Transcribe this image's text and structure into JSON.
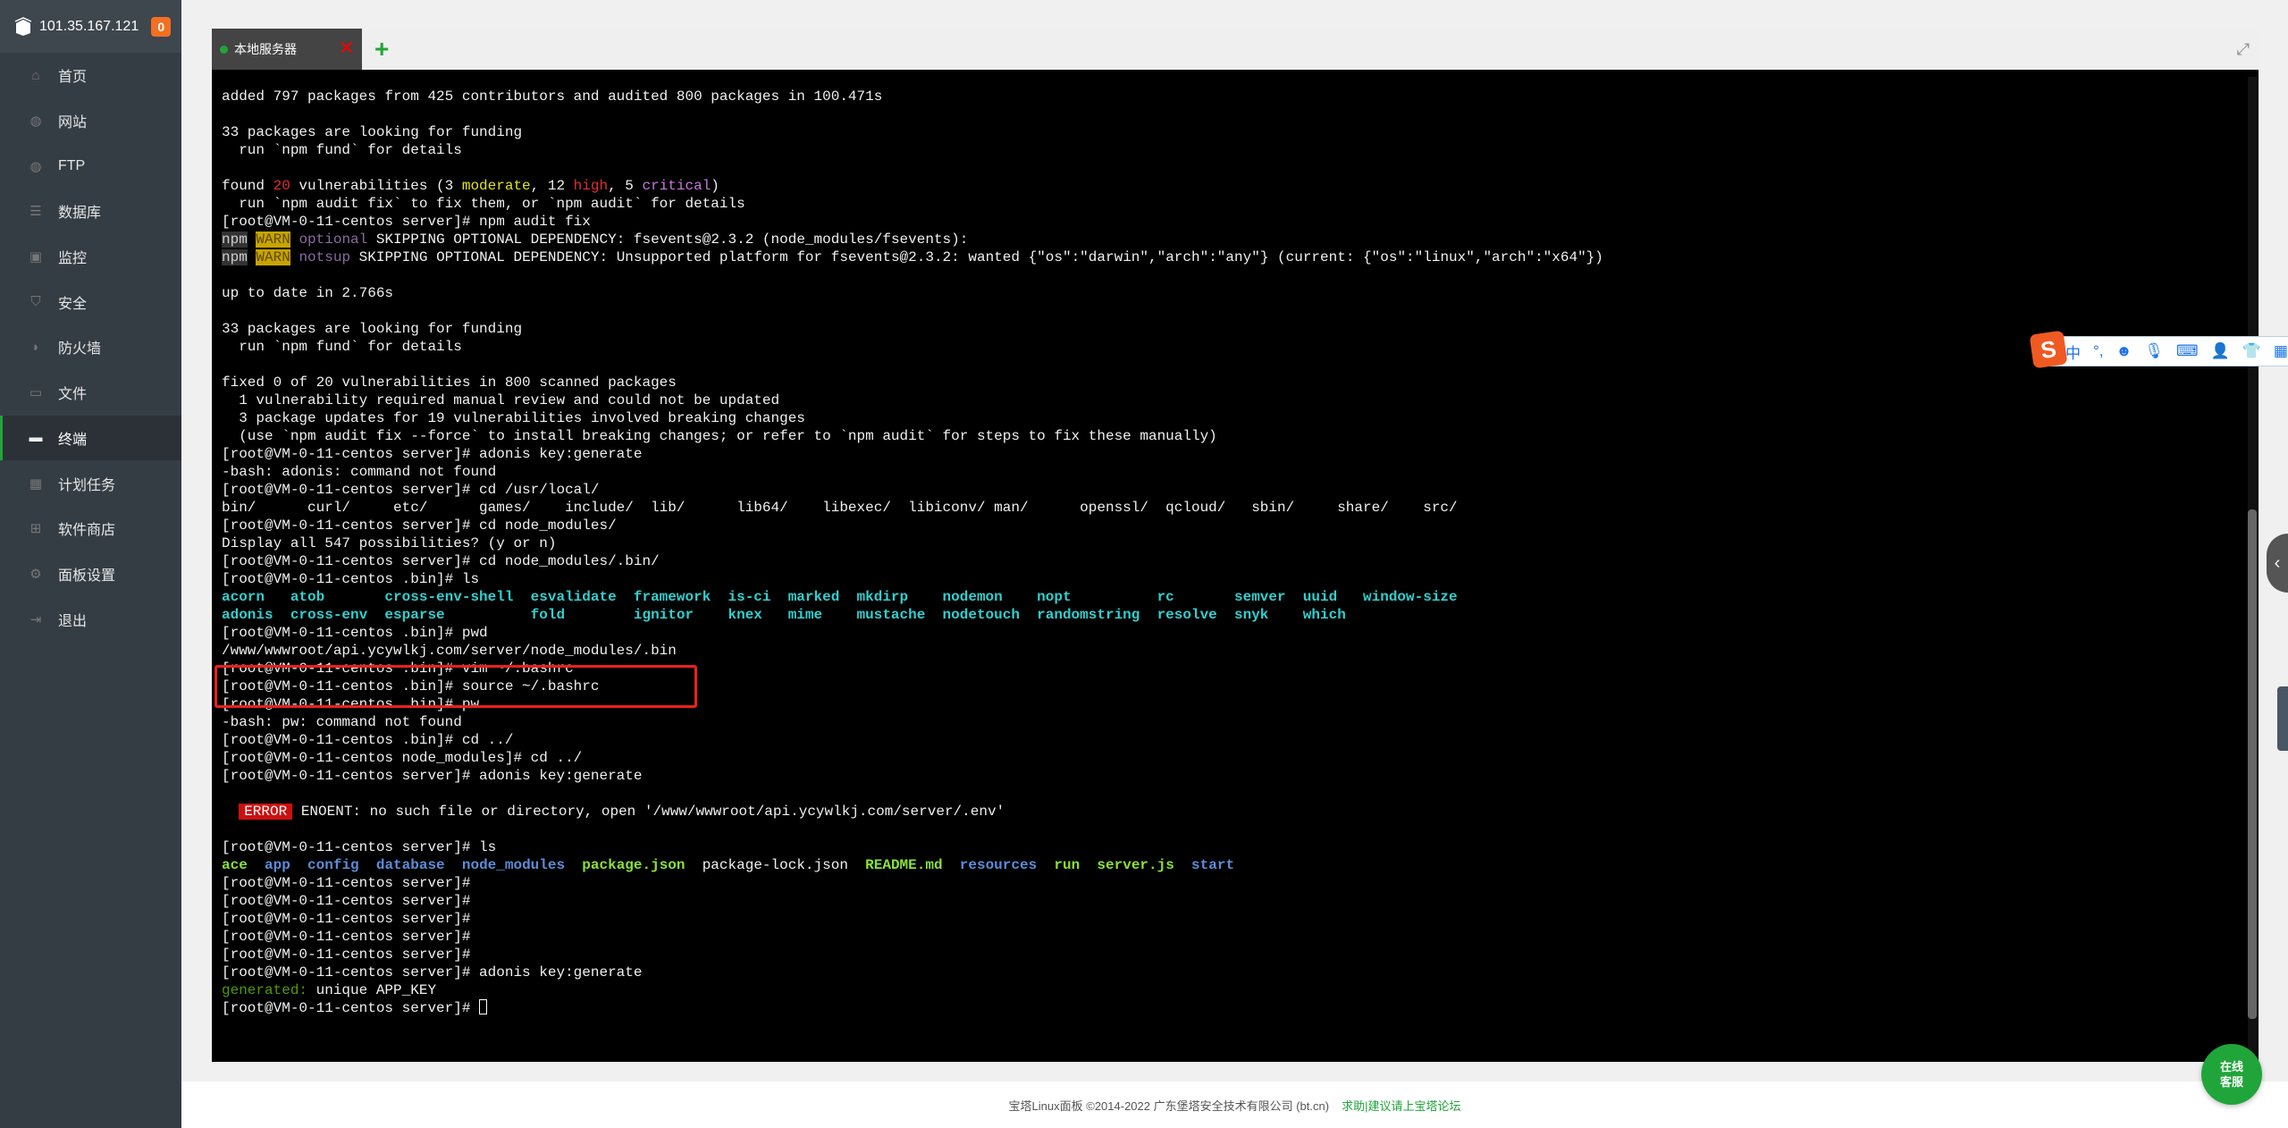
{
  "sidebar": {
    "server_ip": "101.35.167.121",
    "notification_count": "0",
    "items": [
      {
        "label": "首页",
        "icon": "home-icon"
      },
      {
        "label": "网站",
        "icon": "globe-icon"
      },
      {
        "label": "FTP",
        "icon": "ftp-icon"
      },
      {
        "label": "数据库",
        "icon": "database-icon"
      },
      {
        "label": "监控",
        "icon": "monitor-icon"
      },
      {
        "label": "安全",
        "icon": "shield-icon"
      },
      {
        "label": "防火墙",
        "icon": "firewall-icon"
      },
      {
        "label": "文件",
        "icon": "folder-icon"
      },
      {
        "label": "终端",
        "icon": "terminal-icon",
        "active": true
      },
      {
        "label": "计划任务",
        "icon": "calendar-icon"
      },
      {
        "label": "软件商店",
        "icon": "apps-icon"
      },
      {
        "label": "面板设置",
        "icon": "gear-icon"
      },
      {
        "label": "退出",
        "icon": "logout-icon"
      }
    ]
  },
  "tabs": {
    "active_tab": "本地服务器",
    "add_label": "+"
  },
  "terminal": {
    "prompt_server": "[root@VM-0-11-centos server]# ",
    "prompt_bin": "[root@VM-0-11-centos .bin]# ",
    "prompt_nm": "[root@VM-0-11-centos node_modules]# ",
    "l1": "added 797 packages from 425 contributors and audited 800 packages in 100.471s",
    "l2": "33 packages are looking for funding",
    "l3": "  run `npm fund` for details",
    "found_pre": "found ",
    "found_num": "20",
    "found_mid": " vulnerabilities (3 ",
    "moderate": "moderate",
    "found_mid2": ", 12 ",
    "high": "high",
    "found_mid3": ", 5 ",
    "critical": "critical",
    "found_end": ")",
    "l5": "  run `npm audit fix` to fix them, or `npm audit` for details",
    "cmd_audit": "npm audit fix",
    "npm": "npm",
    "warn": "WARN",
    "optional": "optional",
    "notsup": "notsup",
    "warn1": " SKIPPING OPTIONAL DEPENDENCY: fsevents@2.3.2 (node_modules/fsevents):",
    "warn2": " SKIPPING OPTIONAL DEPENDENCY: Unsupported platform for fsevents@2.3.2: wanted {\"os\":\"darwin\",\"arch\":\"any\"} (current: {\"os\":\"linux\",\"arch\":\"x64\"})",
    "l9": "up to date in 2.766s",
    "l10": "33 packages are looking for funding",
    "l11": "  run `npm fund` for details",
    "l12": "fixed 0 of 20 vulnerabilities in 800 scanned packages",
    "l13": "  1 vulnerability required manual review and could not be updated",
    "l14": "  3 package updates for 19 vulnerabilities involved breaking changes",
    "l15": "  (use `npm audit fix --force` to install breaking changes; or refer to `npm audit` for steps to fix these manually)",
    "cmd_adonis": "adonis key:generate",
    "l17": "-bash: adonis: command not found",
    "cmd_cd_local": "cd /usr/local/",
    "l19": "bin/      curl/     etc/      games/    include/  lib/      lib64/    libexec/  libiconv/ man/      openssl/  qcloud/   sbin/     share/    src/",
    "cmd_cd_nm": "cd node_modules/",
    "l21": "Display all 547 possibilities? (y or n)",
    "cmd_cd_bin": "cd node_modules/.bin/",
    "cmd_ls": "ls",
    "bin_row1": "acorn   atob       cross-env-shell  esvalidate  framework  is-ci  marked  mkdirp    nodemon    nopt          rc       semver  uuid   window-size",
    "bin_row2": "adonis  cross-env  esparse          fold        ignitor    knex   mime    mustache  nodetouch  randomstring  resolve  snyk    which",
    "cmd_pwd": "pwd",
    "l27": "/www/wwwroot/api.ycywlkj.com/server/node_modules/.bin",
    "cmd_vim": "vim ~/.bashrc",
    "cmd_source": "source ~/.bashrc",
    "cmd_pw": "pw",
    "l31": "-bash: pw: command not found",
    "cmd_cdup": "cd ../",
    "err_label": "ERROR",
    "err_msg": " ENOENT: no such file or directory, open '/www/wwwroot/api.ycywlkj.com/server/.env'",
    "ls_ace": "ace",
    "ls_app": "app",
    "ls_config": "config",
    "ls_database": "database",
    "ls_node_modules": "node_modules",
    "ls_package": "package.json",
    "ls_lock": "package-lock.json",
    "ls_readme": "README.md",
    "ls_resources": "resources",
    "ls_run": "run",
    "ls_server": "server.js",
    "ls_start": "start",
    "generated": "generated:",
    "generated_msg": " unique APP_KEY"
  },
  "ime": {
    "lang": "中",
    "punct": "°,"
  },
  "footer": {
    "copyright": "宝塔Linux面板 ©2014-2022 广东堡塔安全技术有限公司 (bt.cn)",
    "help_link": "求助|建议请上宝塔论坛"
  },
  "chat_button": {
    "line1": "在线",
    "line2": "客服"
  },
  "colors": {
    "accent": "#20a53a",
    "badge": "#f36f21",
    "error": "#cc1010",
    "highlight_box": "#e8221a"
  }
}
